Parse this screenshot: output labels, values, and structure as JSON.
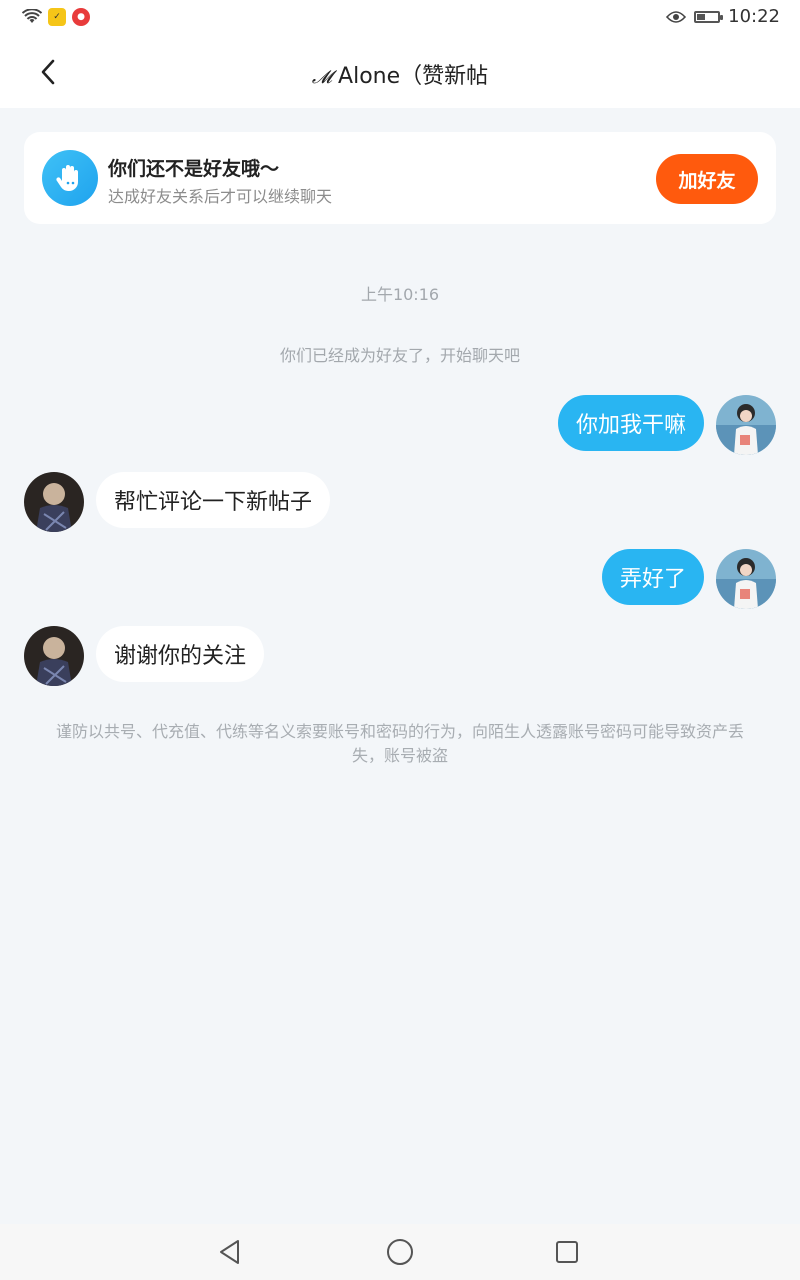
{
  "status_bar": {
    "time": "10:22",
    "icons": [
      "wifi-icon",
      "app-notification-icon",
      "app-notification-icon-2",
      "eye-icon",
      "battery-icon"
    ],
    "battery_level": 0.4
  },
  "header": {
    "back_icon": "chevron-left-icon",
    "title_prefix": "𝓜",
    "title": "Alone（赞新帖"
  },
  "friend_banner": {
    "icon": "hand-icon",
    "title": "你们还不是好友哦～",
    "subtitle": "达成好友关系后才可以继续聊天",
    "add_button": "加好友",
    "accent_color": "#ff5a0d"
  },
  "chat": {
    "timestamp": "上午10:16",
    "system_note": "你们已经成为好友了，开始聊天吧",
    "messages": [
      {
        "sender": "me",
        "text": "你加我干嘛"
      },
      {
        "sender": "them",
        "text": "帮忙评论一下新帖子"
      },
      {
        "sender": "me",
        "text": "弄好了"
      },
      {
        "sender": "them",
        "text": "谢谢你的关注"
      }
    ],
    "bubble_color_me": "#29b5f2",
    "bubble_color_them": "#ffffff"
  },
  "warning": "谨防以共号、代充值、代练等名义索要账号和密码的行为，向陌生人透露账号密码可能导致资产丢失，账号被盗",
  "nav_bar": {
    "icons": [
      "back-triangle-icon",
      "home-circle-icon",
      "recents-square-icon"
    ]
  }
}
